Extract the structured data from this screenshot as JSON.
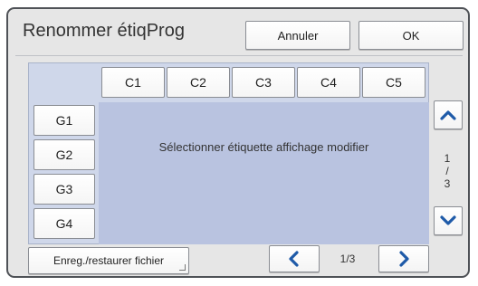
{
  "dialog": {
    "title": "Renommer étiqProg",
    "cancel_label": "Annuler",
    "ok_label": "OK"
  },
  "columns": [
    "C1",
    "C2",
    "C3",
    "C4",
    "C5"
  ],
  "rows": [
    "G1",
    "G2",
    "G3",
    "G4"
  ],
  "message": "Sélectionner étiquette affichage modifier",
  "side_pager": {
    "current": "1",
    "separator": "/",
    "total": "3"
  },
  "footer": {
    "file_button_label": "Enreg./restaurer fichier",
    "page_indicator": "1/3"
  },
  "colors": {
    "accent": "#1e5aa8",
    "panel": "#cfd7ea",
    "panel_inner": "#b9c3e0",
    "frame": "#e6e6e6"
  },
  "icons": {
    "scroll_up": "chevron-up-icon",
    "scroll_down": "chevron-down-icon",
    "prev": "chevron-left-icon",
    "next": "chevron-right-icon"
  }
}
